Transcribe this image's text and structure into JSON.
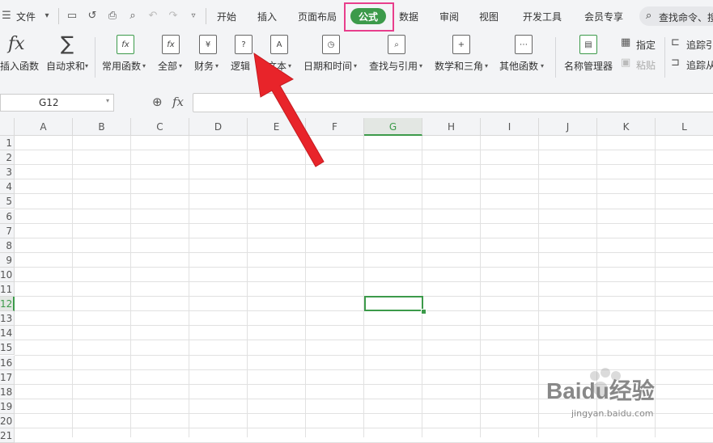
{
  "quick_access": {
    "menu_label": "文件"
  },
  "tabs": [
    {
      "label": "开始"
    },
    {
      "label": "插入"
    },
    {
      "label": "页面布局"
    },
    {
      "label": "公式",
      "active": true
    },
    {
      "label": "数据"
    },
    {
      "label": "审阅"
    },
    {
      "label": "视图"
    },
    {
      "label": "开发工具"
    },
    {
      "label": "会员专享"
    }
  ],
  "search": {
    "placeholder": "查找命令、搜"
  },
  "ribbon": {
    "items": [
      {
        "label": "插入函数"
      },
      {
        "label": "自动求和"
      },
      {
        "label": "常用函数"
      },
      {
        "label": "全部"
      },
      {
        "label": "财务"
      },
      {
        "label": "逻辑"
      },
      {
        "label": "文本"
      },
      {
        "label": "日期和时间"
      },
      {
        "label": "查找与引用"
      },
      {
        "label": "数学和三角"
      },
      {
        "label": "其他函数"
      },
      {
        "label": "名称管理器"
      }
    ],
    "small_items": [
      {
        "label": "指定"
      },
      {
        "label": "粘贴"
      },
      {
        "label": "追踪引"
      },
      {
        "label": "追踪从"
      }
    ],
    "icon_glyphs": {
      "fx": "fx",
      "sum": "∑",
      "finance": "¥",
      "logic": "?",
      "text": "A"
    }
  },
  "formula_bar": {
    "name_box": "G12",
    "fx_label": "fx",
    "value": ""
  },
  "grid": {
    "columns": [
      "A",
      "B",
      "C",
      "D",
      "E",
      "F",
      "G",
      "H",
      "I",
      "J",
      "K",
      "L"
    ],
    "active_column": "G",
    "rows": [
      "1",
      "2",
      "3",
      "4",
      "5",
      "6",
      "7",
      "8",
      "9",
      "10",
      "11",
      "12",
      "13",
      "14",
      "15",
      "16",
      "17",
      "18",
      "19",
      "20",
      "21"
    ],
    "active_row": "12",
    "selected_cell": "G12"
  },
  "watermark": {
    "brand": "Baidu经验",
    "url": "jingyan.baidu.com"
  },
  "colors": {
    "accent": "#3c9a4a",
    "highlight_box": "#e83e8c",
    "arrow": "#e8242a"
  }
}
